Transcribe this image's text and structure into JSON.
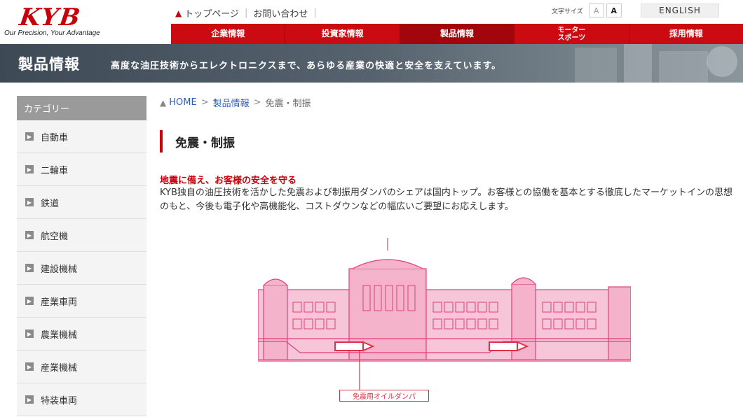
{
  "header": {
    "logo_text": "KYB",
    "logo_tagline": "Our Precision, Your Advantage",
    "top_links": [
      "トップページ",
      "お問い合わせ"
    ],
    "font_size_label": "文字サイズ",
    "font_small": "A",
    "font_large": "A",
    "english_label": "ENGLISH"
  },
  "nav": {
    "items": [
      {
        "label": "企業情報"
      },
      {
        "label": "投資家情報"
      },
      {
        "label": "製品情報"
      },
      {
        "label": "モーター\nスポーツ"
      },
      {
        "label": "採用情報"
      }
    ]
  },
  "banner": {
    "title": "製品情報",
    "subtitle": "高度な油圧技術からエレクトロニクスまで、あらゆる産業の快適と安全を支えています。"
  },
  "sidebar": {
    "heading": "カテゴリー",
    "items": [
      {
        "label": "自動車"
      },
      {
        "label": "二輪車"
      },
      {
        "label": "鉄道"
      },
      {
        "label": "航空機"
      },
      {
        "label": "建設機械"
      },
      {
        "label": "産業車両"
      },
      {
        "label": "農業機械"
      },
      {
        "label": "産業機械"
      },
      {
        "label": "特装車両"
      }
    ]
  },
  "breadcrumb": {
    "home": "HOME",
    "level1": "製品情報",
    "current": "免震・制振",
    "separator": ">"
  },
  "main": {
    "title": "免震・制振",
    "lead_heading": "地震に備え、お客様の安全を守る",
    "lead_body": "KYB独自の油圧技術を活かした免震および制振用ダンパのシェアは国内トップ。お客様との協働を基本とする徹底したマーケットインの思想のもと、今後も電子化や高機能化、コストダウンなどの幅広いご要望にお応えします。",
    "illustration_label": "免震用オイルダンパ"
  },
  "colors": {
    "brand_red": "#cc0a12",
    "illustration_pink": "#e0407a"
  }
}
